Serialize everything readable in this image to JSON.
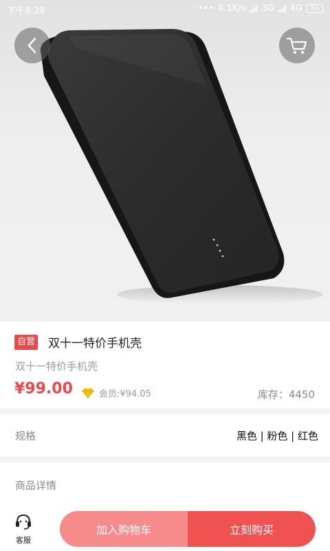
{
  "status_bar": {
    "time": "下午4:39",
    "dots": "•••",
    "speed": "0.1K/s",
    "network_1": "3G",
    "network_2": "4G",
    "battery": "51"
  },
  "product": {
    "badge": "自营",
    "title": "双十一特价手机壳",
    "subtitle": "双十一特价手机壳",
    "price": "¥99.00",
    "member_price": "会员:¥94.05",
    "stock": "库存：4450"
  },
  "spec": {
    "label": "规格",
    "value": "黑色 | 粉色 | 红色"
  },
  "details": {
    "label": "商品详情"
  },
  "bottom_bar": {
    "service_label": "客服",
    "add_to_cart": "加入购物车",
    "buy_now": "立刻购买"
  },
  "colors": {
    "accent": "#e84a4a",
    "add_button": "#f78b8b",
    "buy_button": "#f05252"
  },
  "icons": {
    "back": "chevron-left-icon",
    "cart": "shopping-cart-icon",
    "vip": "diamond-icon",
    "service": "headset-icon"
  }
}
